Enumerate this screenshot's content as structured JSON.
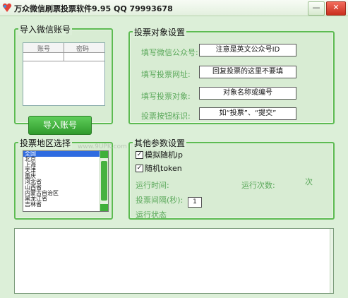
{
  "window": {
    "title": "万众微信刷票投票软件9.95    QQ 79993678",
    "min_label": "—",
    "close_label": "✕"
  },
  "accounts": {
    "title": "导入微信账号",
    "col_account": "账号",
    "col_password": "密码",
    "import_button": "导入账号"
  },
  "vote_target": {
    "title": "投票对象设置",
    "fields": [
      {
        "label": "填写微信公众号:",
        "value": "注意是英文公众号ID"
      },
      {
        "label": "填写投票网址:",
        "value": "回复投票的这里不要填"
      },
      {
        "label": "填写投票对象:",
        "value": "对象名称或编号"
      },
      {
        "label": "投票按钮标识:",
        "value": "如“投票”、“提交”"
      }
    ]
  },
  "region": {
    "title": "投票地区选择",
    "items": [
      "全国",
      "北京",
      "上海",
      "天津",
      "重庆",
      "河北省",
      "山西省",
      "内蒙古自治区",
      "黑龙江省",
      "吉林省"
    ],
    "selected": "全国"
  },
  "other": {
    "title": "其他参数设置",
    "simulate_ip": "模拟随机ip",
    "random_token": "随机token",
    "run_time_label": "运行时间:",
    "run_count_label": "运行次数:",
    "run_count_unit": "次",
    "interval_label": "投票间隔(秒):",
    "interval_value": "1",
    "status_label": "运行状态"
  },
  "watermark": "www.9UPK.com"
}
